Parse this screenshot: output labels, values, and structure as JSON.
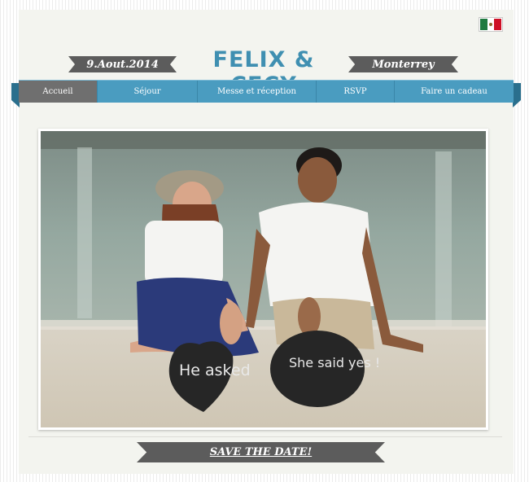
{
  "header": {
    "date": "9.Aout.2014",
    "title": "FELIX & CECY",
    "city": "Monterrey"
  },
  "language_flag": {
    "icon": "mexico-flag-icon",
    "colors": [
      "#1f7a3f",
      "#ffffff",
      "#ce1126"
    ]
  },
  "nav": {
    "items": [
      {
        "label": "Accueil",
        "active": true
      },
      {
        "label": "Séjour",
        "active": false
      },
      {
        "label": "Messe et réception",
        "active": false
      },
      {
        "label": "RSVP",
        "active": false
      },
      {
        "label": "Faire un cadeau",
        "active": false
      }
    ]
  },
  "photo": {
    "sign_left": "He asked",
    "sign_right": "She said yes !"
  },
  "cta": {
    "label": "SAVE THE DATE!"
  },
  "colors": {
    "accent": "#4a9cc0",
    "title": "#3f8fb1",
    "ribbon": "#5c5c5c",
    "active_tab": "#6f6f6f"
  }
}
